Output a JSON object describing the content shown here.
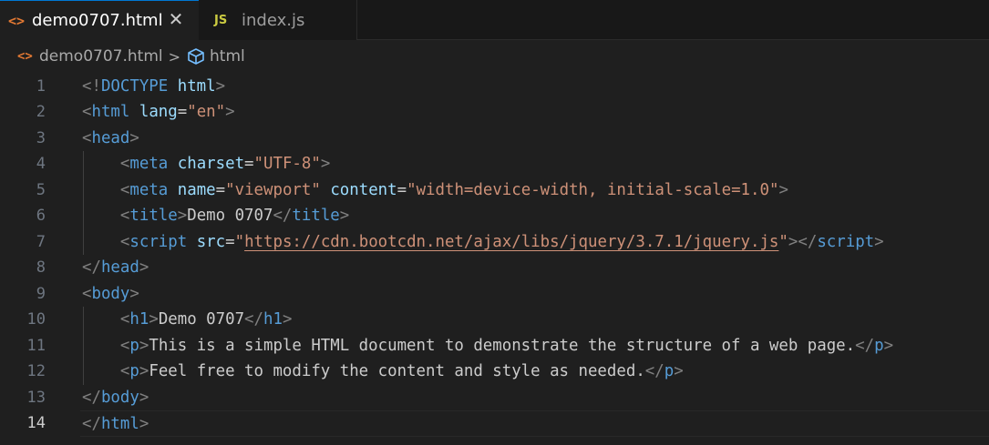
{
  "tabs": [
    {
      "icon": "<>",
      "label": "demo0707.html",
      "close": "✕"
    },
    {
      "icon": "JS",
      "label": "index.js"
    }
  ],
  "breadcrumb": {
    "file_icon": "<>",
    "file": "demo0707.html",
    "separator": ">",
    "symbol": "html"
  },
  "editor": {
    "current_line": 14,
    "lines": [
      {
        "n": "1",
        "tokens": [
          [
            "br",
            "<!"
          ],
          [
            "tag",
            "DOCTYPE"
          ],
          [
            "txt",
            " "
          ],
          [
            "attr",
            "html"
          ],
          [
            "br",
            ">"
          ]
        ]
      },
      {
        "n": "2",
        "tokens": [
          [
            "br",
            "<"
          ],
          [
            "tag",
            "html"
          ],
          [
            "txt",
            " "
          ],
          [
            "attr",
            "lang"
          ],
          [
            "txt",
            "="
          ],
          [
            "str",
            "\"en\""
          ],
          [
            "br",
            ">"
          ]
        ]
      },
      {
        "n": "3",
        "tokens": [
          [
            "br",
            "<"
          ],
          [
            "tag",
            "head"
          ],
          [
            "br",
            ">"
          ]
        ]
      },
      {
        "n": "4",
        "tokens": [
          [
            "txt",
            "    "
          ],
          [
            "br",
            "<"
          ],
          [
            "tag",
            "meta"
          ],
          [
            "txt",
            " "
          ],
          [
            "attr",
            "charset"
          ],
          [
            "txt",
            "="
          ],
          [
            "str",
            "\"UTF-8\""
          ],
          [
            "br",
            ">"
          ]
        ]
      },
      {
        "n": "5",
        "tokens": [
          [
            "txt",
            "    "
          ],
          [
            "br",
            "<"
          ],
          [
            "tag",
            "meta"
          ],
          [
            "txt",
            " "
          ],
          [
            "attr",
            "name"
          ],
          [
            "txt",
            "="
          ],
          [
            "str",
            "\"viewport\""
          ],
          [
            "txt",
            " "
          ],
          [
            "attr",
            "content"
          ],
          [
            "txt",
            "="
          ],
          [
            "str",
            "\"width=device-width, initial-scale=1.0\""
          ],
          [
            "br",
            ">"
          ]
        ]
      },
      {
        "n": "6",
        "tokens": [
          [
            "txt",
            "    "
          ],
          [
            "br",
            "<"
          ],
          [
            "tag",
            "title"
          ],
          [
            "br",
            ">"
          ],
          [
            "txt",
            "Demo 0707"
          ],
          [
            "br",
            "</"
          ],
          [
            "tag",
            "title"
          ],
          [
            "br",
            ">"
          ]
        ]
      },
      {
        "n": "7",
        "tokens": [
          [
            "txt",
            "    "
          ],
          [
            "br",
            "<"
          ],
          [
            "tag",
            "script"
          ],
          [
            "txt",
            " "
          ],
          [
            "attr",
            "src"
          ],
          [
            "txt",
            "="
          ],
          [
            "str",
            "\""
          ],
          [
            "link",
            "https://cdn.bootcdn.net/ajax/libs/jquery/3.7.1/jquery.js"
          ],
          [
            "str",
            "\""
          ],
          [
            "br",
            "></"
          ],
          [
            "tag",
            "script"
          ],
          [
            "br",
            ">"
          ]
        ]
      },
      {
        "n": "8",
        "tokens": [
          [
            "br",
            "</"
          ],
          [
            "tag",
            "head"
          ],
          [
            "br",
            ">"
          ]
        ]
      },
      {
        "n": "9",
        "tokens": [
          [
            "br",
            "<"
          ],
          [
            "tag",
            "body"
          ],
          [
            "br",
            ">"
          ]
        ]
      },
      {
        "n": "10",
        "tokens": [
          [
            "txt",
            "    "
          ],
          [
            "br",
            "<"
          ],
          [
            "tag",
            "h1"
          ],
          [
            "br",
            ">"
          ],
          [
            "txt",
            "Demo 0707"
          ],
          [
            "br",
            "</"
          ],
          [
            "tag",
            "h1"
          ],
          [
            "br",
            ">"
          ]
        ]
      },
      {
        "n": "11",
        "tokens": [
          [
            "txt",
            "    "
          ],
          [
            "br",
            "<"
          ],
          [
            "tag",
            "p"
          ],
          [
            "br",
            ">"
          ],
          [
            "txt",
            "This is a simple HTML document to demonstrate the structure of a web page."
          ],
          [
            "br",
            "</"
          ],
          [
            "tag",
            "p"
          ],
          [
            "br",
            ">"
          ]
        ]
      },
      {
        "n": "12",
        "tokens": [
          [
            "txt",
            "    "
          ],
          [
            "br",
            "<"
          ],
          [
            "tag",
            "p"
          ],
          [
            "br",
            ">"
          ],
          [
            "txt",
            "Feel free to modify the content and style as needed."
          ],
          [
            "br",
            "</"
          ],
          [
            "tag",
            "p"
          ],
          [
            "br",
            ">"
          ]
        ]
      },
      {
        "n": "13",
        "tokens": [
          [
            "br",
            "</"
          ],
          [
            "tag",
            "body"
          ],
          [
            "br",
            ">"
          ]
        ]
      },
      {
        "n": "14",
        "tokens": [
          [
            "br",
            "</"
          ],
          [
            "tag",
            "html"
          ],
          [
            "br",
            ">"
          ]
        ]
      }
    ]
  }
}
